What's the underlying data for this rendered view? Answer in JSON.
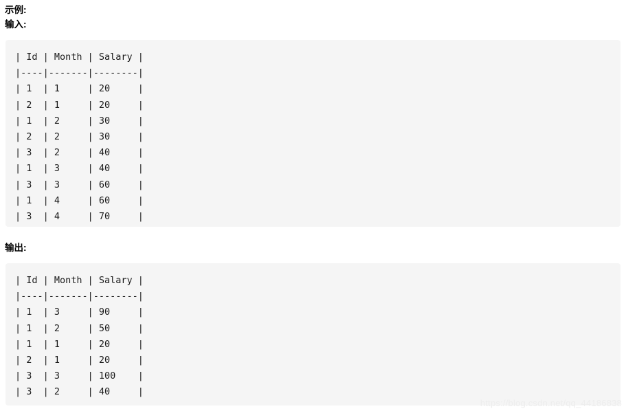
{
  "document": {
    "headings": {
      "example": "示例:",
      "input": "输入:",
      "output": "输出:"
    },
    "input_block": {
      "header_row": "| Id | Month | Salary |",
      "separator_row": "|----|-------|--------|",
      "columns": [
        "Id",
        "Month",
        "Salary"
      ],
      "rows": [
        {
          "Id": "1",
          "Month": "1",
          "Salary": "20"
        },
        {
          "Id": "2",
          "Month": "1",
          "Salary": "20"
        },
        {
          "Id": "1",
          "Month": "2",
          "Salary": "30"
        },
        {
          "Id": "2",
          "Month": "2",
          "Salary": "30"
        },
        {
          "Id": "3",
          "Month": "2",
          "Salary": "40"
        },
        {
          "Id": "1",
          "Month": "3",
          "Salary": "40"
        },
        {
          "Id": "3",
          "Month": "3",
          "Salary": "60"
        },
        {
          "Id": "1",
          "Month": "4",
          "Salary": "60"
        },
        {
          "Id": "3",
          "Month": "4",
          "Salary": "70"
        }
      ],
      "text": "| Id | Month | Salary |\n|----|-------|--------|\n| 1  | 1     | 20     |\n| 2  | 1     | 20     |\n| 1  | 2     | 30     |\n| 2  | 2     | 30     |\n| 3  | 2     | 40     |\n| 1  | 3     | 40     |\n| 3  | 3     | 60     |\n| 1  | 4     | 60     |\n| 3  | 4     | 70     |"
    },
    "output_block": {
      "header_row": "| Id | Month | Salary |",
      "separator_row": "|----|-------|--------|",
      "columns": [
        "Id",
        "Month",
        "Salary"
      ],
      "rows": [
        {
          "Id": "1",
          "Month": "3",
          "Salary": "90"
        },
        {
          "Id": "1",
          "Month": "2",
          "Salary": "50"
        },
        {
          "Id": "1",
          "Month": "1",
          "Salary": "20"
        },
        {
          "Id": "2",
          "Month": "1",
          "Salary": "20"
        },
        {
          "Id": "3",
          "Month": "3",
          "Salary": "100"
        },
        {
          "Id": "3",
          "Month": "2",
          "Salary": "40"
        }
      ],
      "text": "| Id | Month | Salary |\n|----|-------|--------|\n| 1  | 3     | 90     |\n| 1  | 2     | 50     |\n| 1  | 1     | 20     |\n| 2  | 1     | 20     |\n| 3  | 3     | 100    |\n| 3  | 2     | 40     |"
    },
    "watermark": "https://blog.csdn.net/qq_44186838",
    "colors": {
      "code_background": "#f5f5f5",
      "text": "#1a1a1a",
      "watermark": "#ededed",
      "page_background": "#ffffff"
    }
  }
}
